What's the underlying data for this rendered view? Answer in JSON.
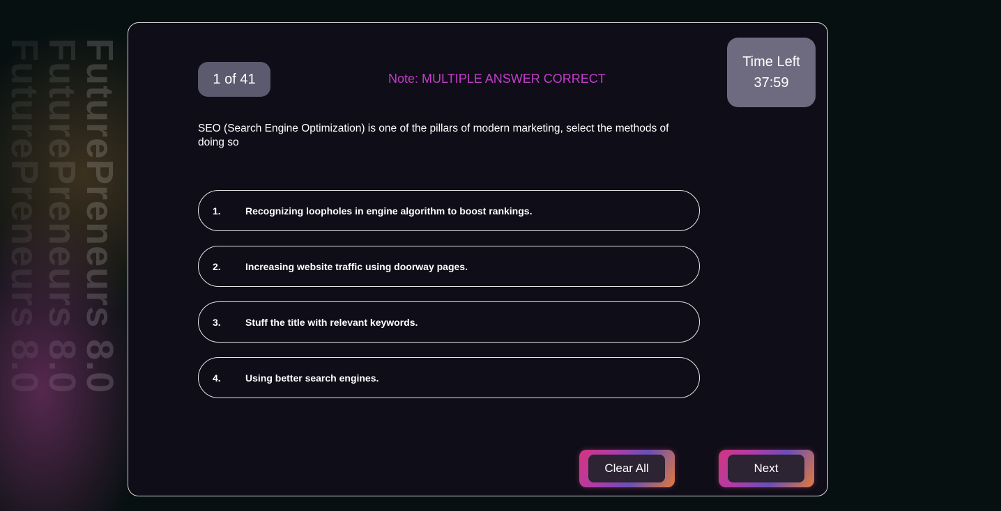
{
  "background": {
    "watermark_lines": [
      "FuturePreneurs 8.0",
      "FuturePreneurs 8.0",
      "FuturePreneurs 8.0"
    ]
  },
  "quiz": {
    "counter": "1 of 41",
    "note": "Note: MULTIPLE ANSWER CORRECT",
    "timer_label": "Time Left",
    "timer_value": "37:59",
    "question": "SEO (Search Engine Optimization) is one of the pillars of modern marketing, select the methods of doing so",
    "options": [
      {
        "number": "1.",
        "text": "Recognizing loopholes in engine algorithm to boost rankings."
      },
      {
        "number": "2.",
        "text": "Increasing website traffic using doorway pages."
      },
      {
        "number": "3.",
        "text": "Stuff the title with relevant keywords."
      },
      {
        "number": "4.",
        "text": "Using better search engines."
      }
    ],
    "buttons": {
      "clear_all": "Clear All",
      "next": "Next"
    }
  },
  "colors": {
    "note_accent": "#c13ec6",
    "card_background": "#0f0d18",
    "page_background": "#071010"
  }
}
